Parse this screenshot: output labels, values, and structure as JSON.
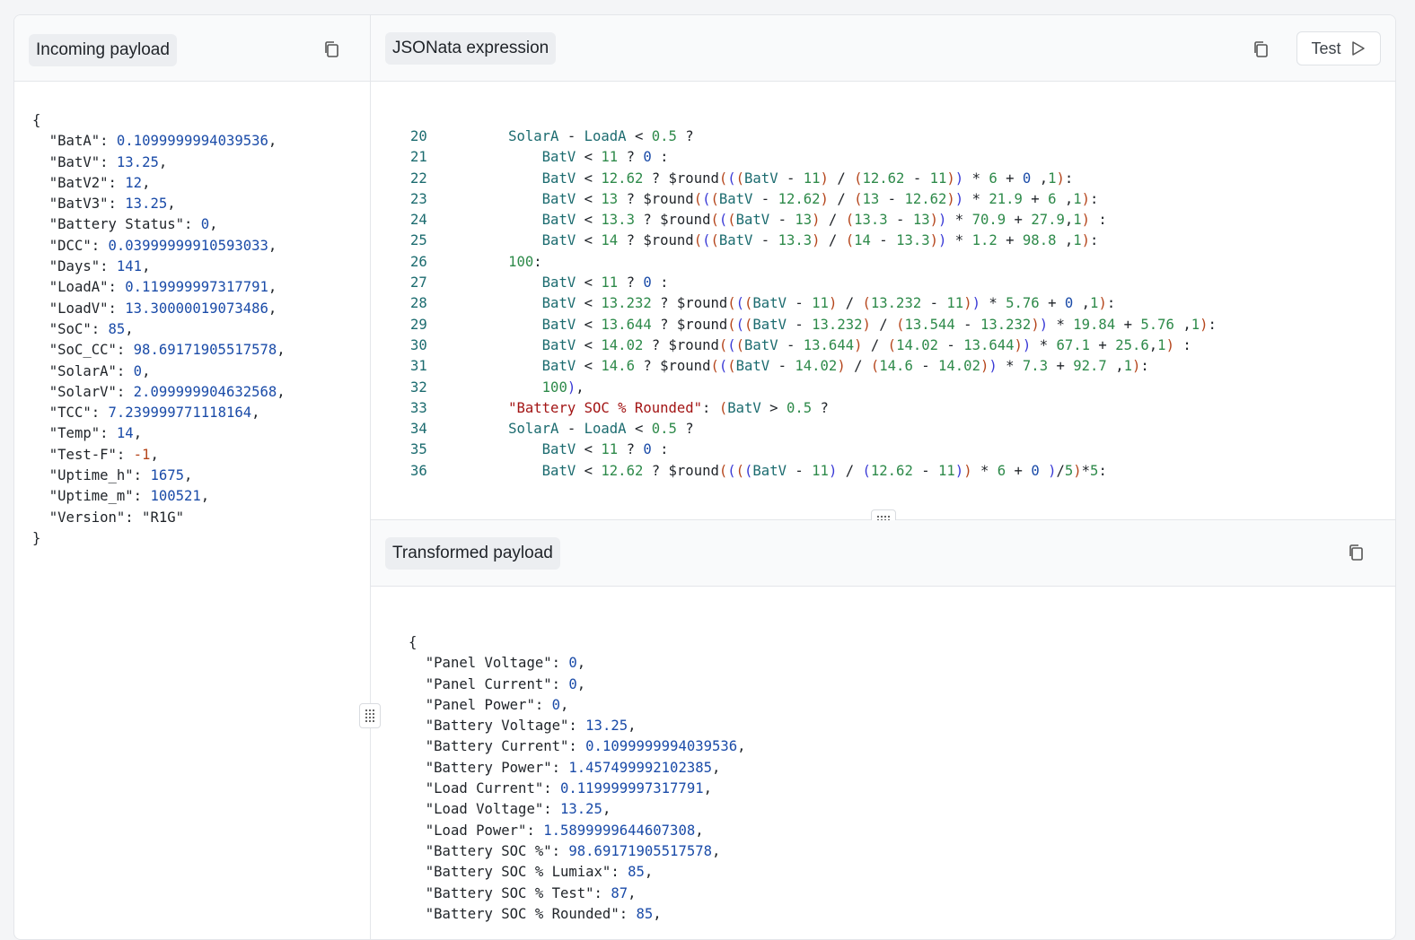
{
  "incoming": {
    "title": "Incoming payload",
    "lines": [
      "{",
      "  \"BatA\": 0.1099999994039536,",
      "  \"BatV\": 13.25,",
      "  \"BatV2\": 12,",
      "  \"BatV3\": 13.25,",
      "  \"Battery Status\": 0,",
      "  \"DCC\": 0.03999999910593033,",
      "  \"Days\": 141,",
      "  \"LoadA\": 0.119999997317791,",
      "  \"LoadV\": 13.30000019073486,",
      "  \"SoC\": 85,",
      "  \"SoC_CC\": 98.69171905517578,",
      "  \"SolarA\": 0,",
      "  \"SolarV\": 2.099999904632568,",
      "  \"TCC\": 7.239999771118164,",
      "  \"Temp\": 14,",
      "  \"Test-F\": -1,",
      "  \"Uptime_h\": 1675,",
      "  \"Uptime_m\": 100521,",
      "  \"Version\": \"R1G\"",
      "}"
    ]
  },
  "expression": {
    "title": "JSONata expression",
    "test_label": "Test",
    "line_numbers": [
      "20",
      "21",
      "22",
      "23",
      "24",
      "25",
      "26",
      "27",
      "28",
      "29",
      "30",
      "31",
      "32",
      "33",
      "34",
      "35",
      "36"
    ],
    "lines": [
      "        SolarA - LoadA < 0.5 ?",
      "            BatV < 11 ? 0 :",
      "            BatV < 12.62 ? $round(((BatV - 11) / (12.62 - 11)) * 6 + 0 ,1):",
      "            BatV < 13 ? $round(((BatV - 12.62) / (13 - 12.62)) * 21.9 + 6 ,1):",
      "            BatV < 13.3 ? $round(((BatV - 13) / (13.3 - 13)) * 70.9 + 27.9,1) :",
      "            BatV < 14 ? $round(((BatV - 13.3) / (14 - 13.3)) * 1.2 + 98.8 ,1):",
      "        100:",
      "            BatV < 11 ? 0 :",
      "            BatV < 13.232 ? $round(((BatV - 11) / (13.232 - 11)) * 5.76 + 0 ,1):",
      "            BatV < 13.644 ? $round(((BatV - 13.232) / (13.544 - 13.232)) * 19.84 + 5.76 ,1):",
      "            BatV < 14.02 ? $round(((BatV - 13.644) / (14.02 - 13.644)) * 67.1 + 25.6,1) :",
      "            BatV < 14.6 ? $round(((BatV - 14.02) / (14.6 - 14.02)) * 7.3 + 92.7 ,1):",
      "            100),",
      "        \"Battery SOC % Rounded\": (BatV > 0.5 ?",
      "        SolarA - LoadA < 0.5 ?",
      "            BatV < 11 ? 0 :",
      "            BatV < 12.62 ? $round((((BatV - 11) / (12.62 - 11)) * 6 + 0 )/5)*5:"
    ]
  },
  "transformed": {
    "title": "Transformed payload",
    "lines": [
      "{",
      "  \"Panel Voltage\": 0,",
      "  \"Panel Current\": 0,",
      "  \"Panel Power\": 0,",
      "  \"Battery Voltage\": 13.25,",
      "  \"Battery Current\": 0.1099999994039536,",
      "  \"Battery Power\": 1.457499992102385,",
      "  \"Load Current\": 0.119999997317791,",
      "  \"Load Voltage\": 13.25,",
      "  \"Load Power\": 1.5899999644607308,",
      "  \"Battery SOC %\": 98.69171905517578,",
      "  \"Battery SOC % Lumiax\": 85,",
      "  \"Battery SOC % Test\": 87,",
      "  \"Battery SOC % Rounded\": 85,"
    ]
  },
  "icons": [
    "copy-icon",
    "play-icon",
    "drag-handle-icon"
  ]
}
